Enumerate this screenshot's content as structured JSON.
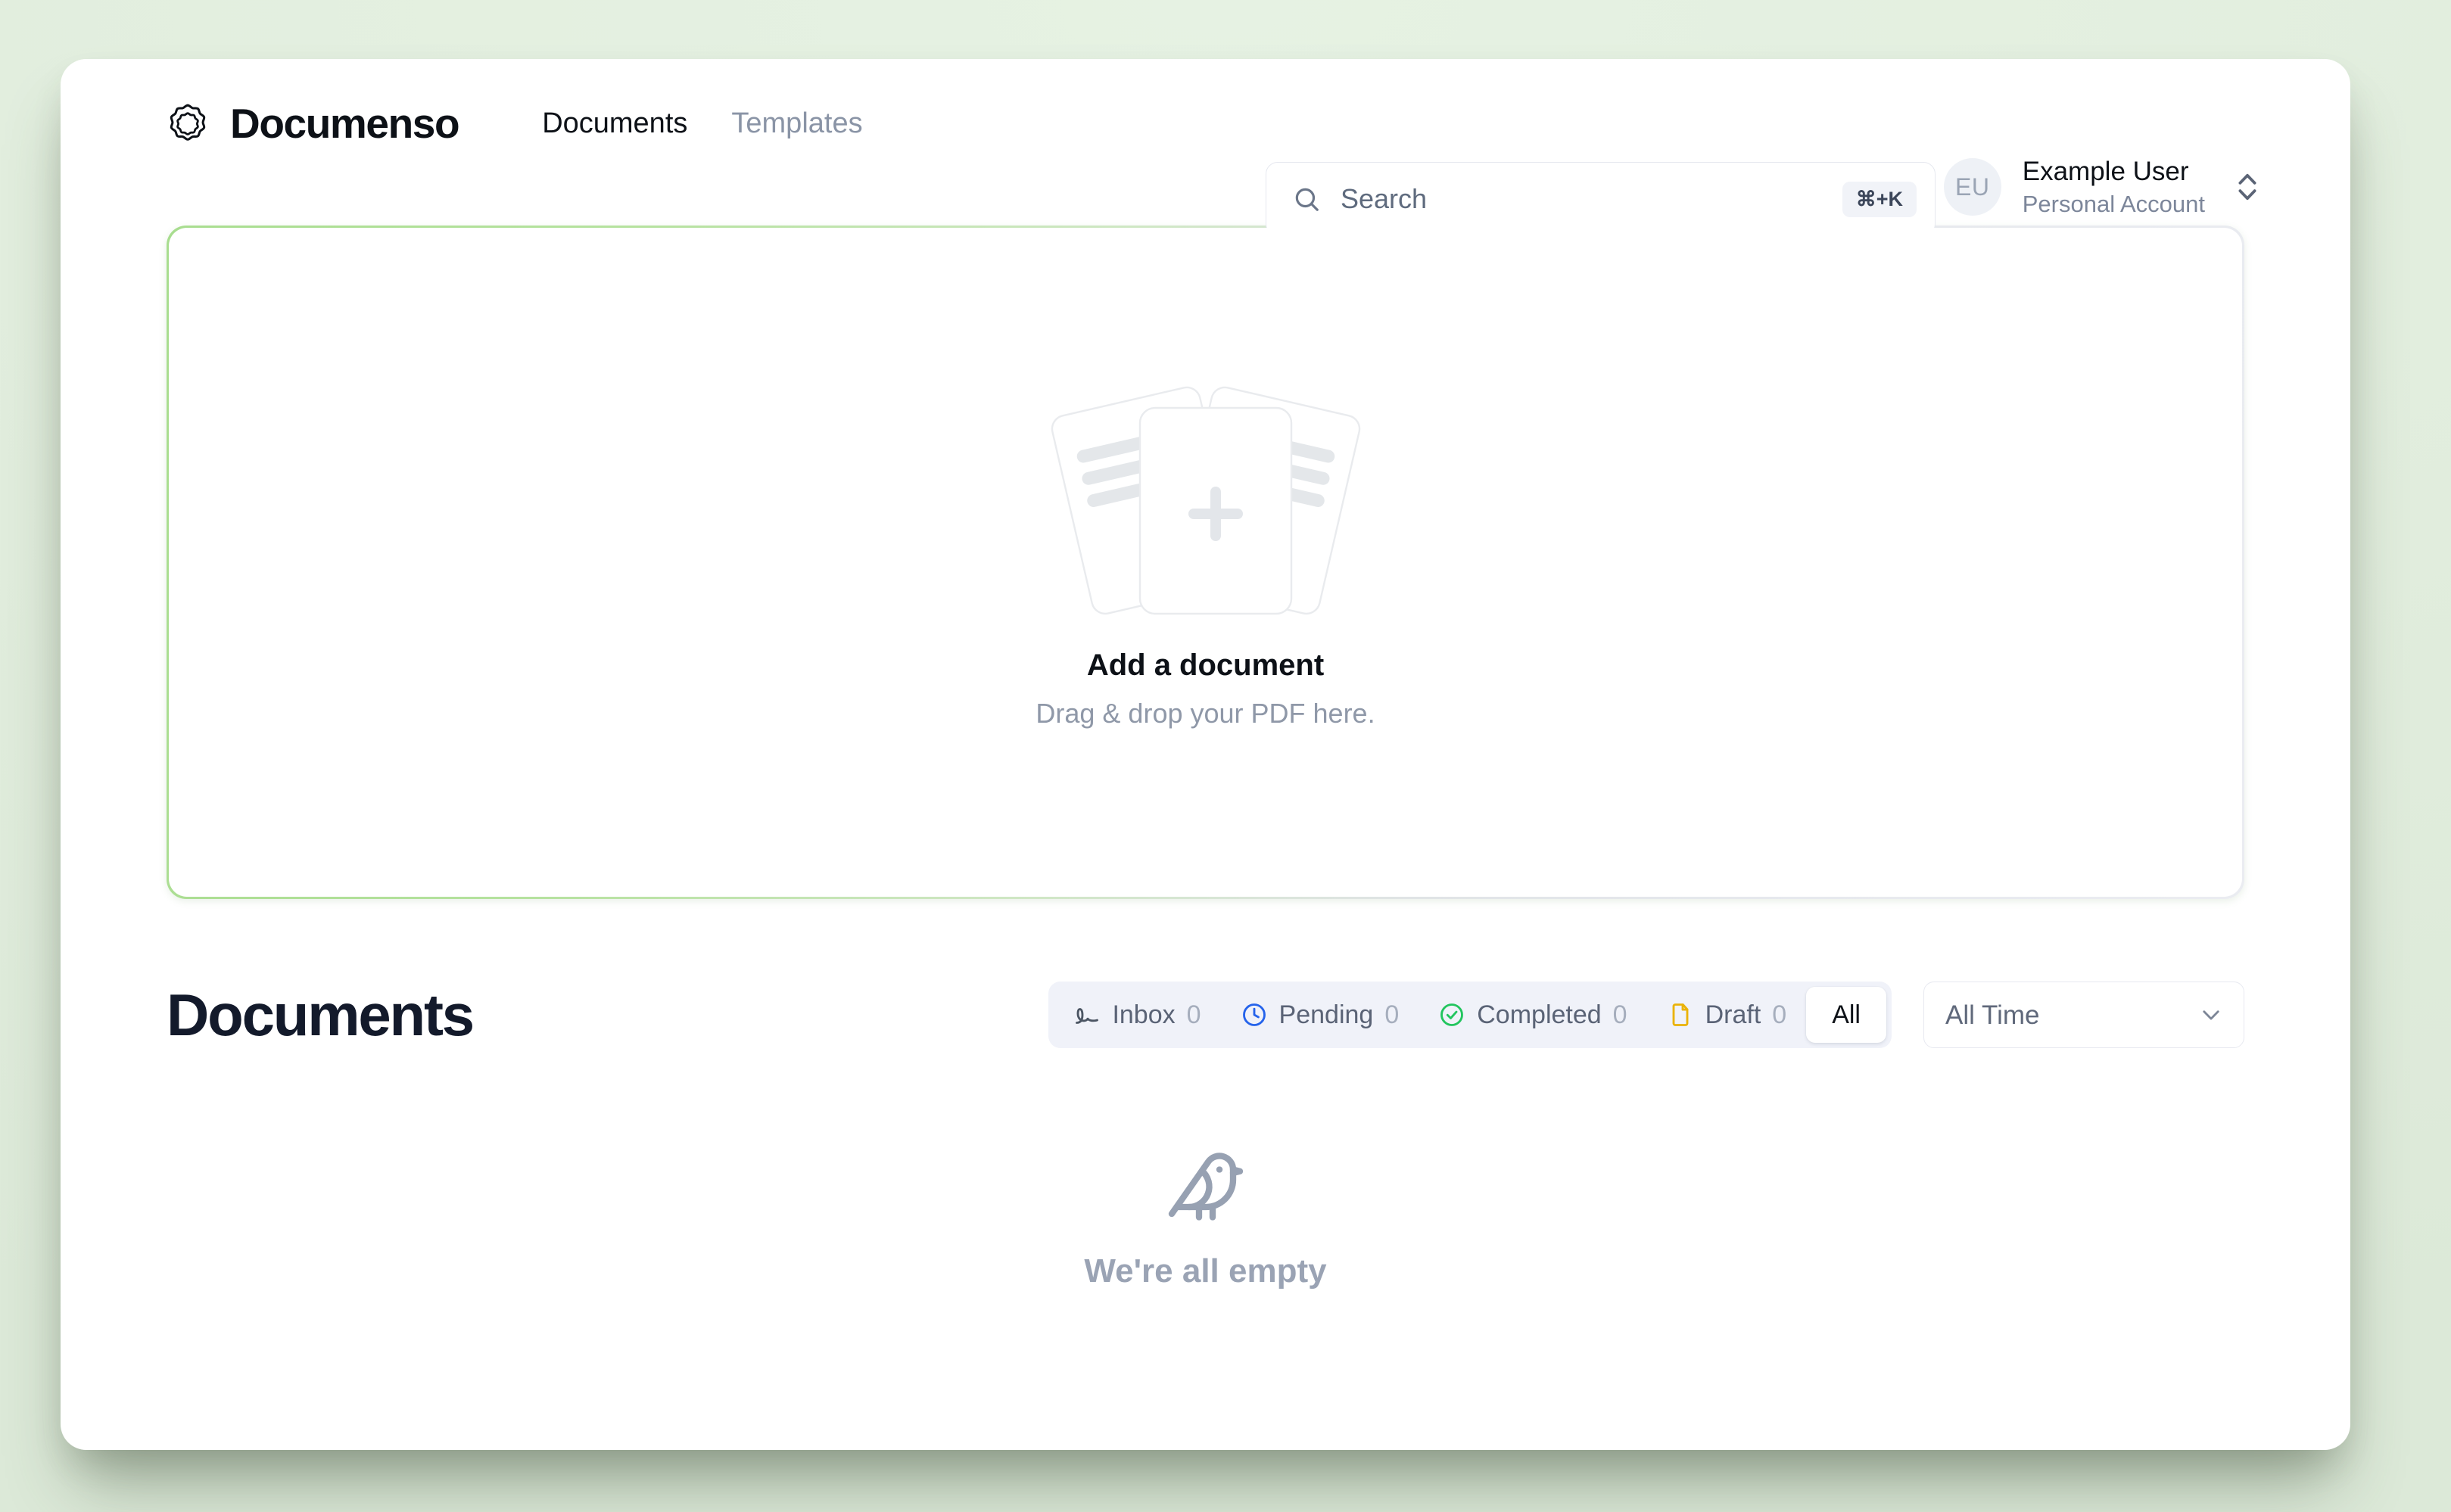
{
  "brand": {
    "name": "Documenso",
    "logo_icon": "documenso-seal-icon"
  },
  "nav": {
    "links": [
      {
        "label": "Documents",
        "active": true
      },
      {
        "label": "Templates",
        "active": false
      }
    ]
  },
  "search": {
    "placeholder": "Search",
    "value": "",
    "shortcut": "⌘+K",
    "icon": "search-icon"
  },
  "account": {
    "initials": "EU",
    "name": "Example User",
    "subtitle": "Personal Account",
    "switch_icon": "chevron-up-down-icon"
  },
  "dropzone": {
    "title": "Add a document",
    "subtitle": "Drag & drop your PDF here.",
    "illustration": "stacked-documents-with-plus-icon",
    "accent_color": "#a8dd8f"
  },
  "documents": {
    "page_title": "Documents",
    "tabs": [
      {
        "label": "Inbox",
        "count": "0",
        "icon": "signature-icon",
        "icon_color": "#4b5563",
        "active": false
      },
      {
        "label": "Pending",
        "count": "0",
        "icon": "clock-icon",
        "icon_color": "#2563eb",
        "active": false
      },
      {
        "label": "Completed",
        "count": "0",
        "icon": "check-circle-icon",
        "icon_color": "#22c55e",
        "active": false
      },
      {
        "label": "Draft",
        "count": "0",
        "icon": "file-icon",
        "icon_color": "#eab308",
        "active": false
      },
      {
        "label": "All",
        "count": "",
        "icon": "",
        "icon_color": "",
        "active": true
      }
    ],
    "date_filter": {
      "selected": "All Time",
      "icon": "chevron-down-icon"
    },
    "empty_state": {
      "icon": "bird-icon",
      "title": "We're all empty",
      "subtitle": ""
    }
  },
  "theme": {
    "page_background": "#e2eedf",
    "card_background": "#ffffff",
    "text_primary": "#0d1117",
    "text_muted": "#8a94a6",
    "tabgroup_background": "#f0f2f9"
  }
}
